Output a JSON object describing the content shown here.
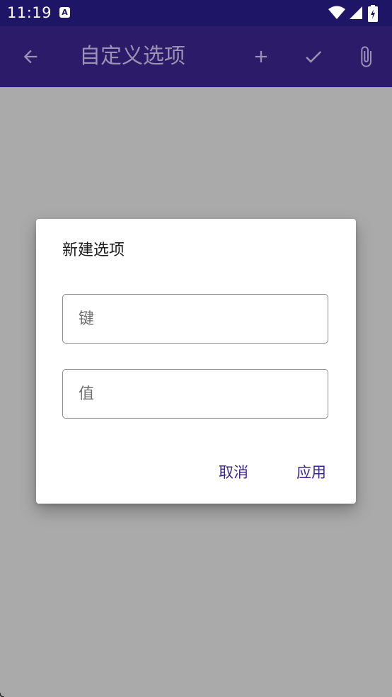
{
  "status_bar": {
    "time": "11:19",
    "notification_glyph": "A",
    "icons": [
      "wifi-icon",
      "cell-signal-icon",
      "battery-charging-icon"
    ]
  },
  "app_bar": {
    "title": "自定义选项",
    "icons": [
      "back-arrow-icon",
      "plus-icon",
      "check-icon",
      "paperclip-icon"
    ],
    "background": "#2c1b68"
  },
  "dialog": {
    "title": "新建选项",
    "key_field": {
      "placeholder": "键",
      "value": ""
    },
    "value_field": {
      "placeholder": "值",
      "value": ""
    },
    "cancel_label": "取消",
    "apply_label": "应用",
    "accent_color": "#3c2590"
  },
  "scrim_color": "#aaaaaa"
}
